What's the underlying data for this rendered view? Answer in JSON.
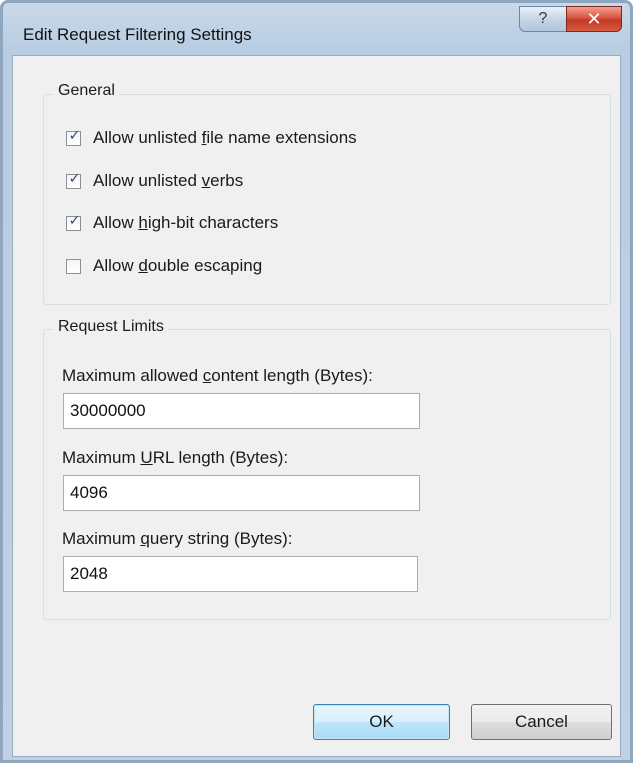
{
  "window": {
    "title": "Edit Request Filtering Settings",
    "help_glyph": "?",
    "close_glyph": "✕"
  },
  "general": {
    "legend": "General",
    "options": [
      {
        "pre": "Allow unlisted ",
        "key": "f",
        "post": "ile name extensions",
        "checked": true
      },
      {
        "pre": "Allow unlisted ",
        "key": "v",
        "post": "erbs",
        "checked": true
      },
      {
        "pre": "Allow ",
        "key": "h",
        "post": "igh-bit characters",
        "checked": true
      },
      {
        "pre": "Allow ",
        "key": "d",
        "post": "ouble escaping",
        "checked": false
      }
    ]
  },
  "request_limits": {
    "legend": "Request Limits",
    "fields": [
      {
        "label_pre": "Maximum allowed ",
        "key": "c",
        "label_post": "ontent length (Bytes):",
        "value": "30000000"
      },
      {
        "label_pre": "Maximum ",
        "key": "U",
        "label_post": "RL length (Bytes):",
        "value": "4096"
      },
      {
        "label_pre": "Maximum ",
        "key": "q",
        "label_post": "uery string (Bytes):",
        "value": "2048"
      }
    ]
  },
  "buttons": {
    "ok": "OK",
    "cancel": "Cancel"
  },
  "check_glyph": "✓"
}
